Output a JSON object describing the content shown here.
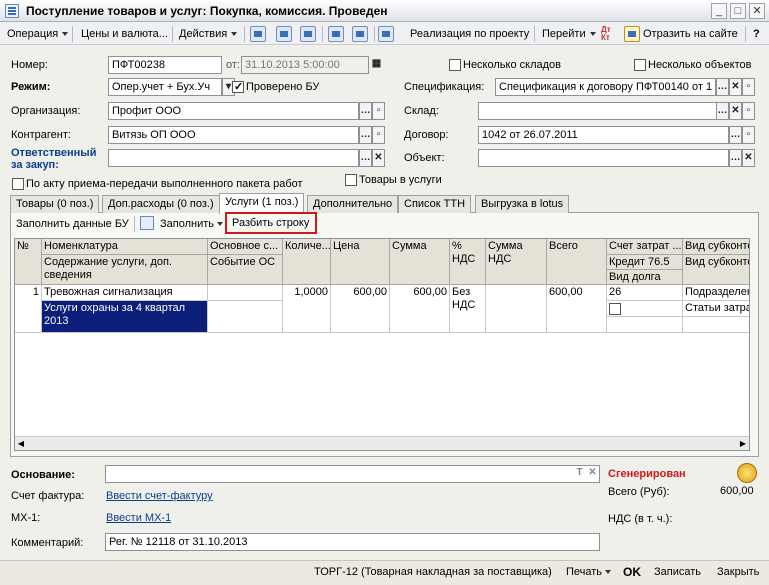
{
  "window": {
    "title": "Поступление товаров и услуг: Покупка, комиссия. Проведен",
    "minimize": "_",
    "maximize": "□",
    "close": "✕"
  },
  "toolbar": {
    "operation": "Операция",
    "prices": "Цены и валюта...",
    "actions": "Действия",
    "realization": "Реализация по проекту",
    "goto": "Перейти",
    "reflect": "Отразить на сайте",
    "dtkt": "Дт Кт"
  },
  "form": {
    "number_label": "Номер:",
    "number": "ПФТ00238",
    "date_label": "от:",
    "date": "31.10.2013  5:00:00",
    "multi_warehouses": "Несколько складов",
    "multi_objects": "Несколько объектов",
    "mode_label": "Режим:",
    "mode": "Опер.учет + Бух.Уч",
    "checked_bu": "Проверено БУ",
    "spec_label": "Спецификация:",
    "spec": "Спецификация к договору ПФТ00140 от 1",
    "org_label": "Организация:",
    "org": "Профит ООО",
    "warehouse_label": "Склад:",
    "warehouse": "",
    "contractor_label": "Контрагент:",
    "contractor": "Витязь ОП ООО",
    "contract_label": "Договор:",
    "contract": "1042 от 26.07.2011",
    "responsible_label": "Ответственный за закуп:",
    "responsible": "",
    "object_label": "Объект:",
    "object": "",
    "by_act": "По акту приема-передачи выполненного пакета работ",
    "goods_services": "Товары в услуги"
  },
  "tabs": [
    "Товары (0 поз.)",
    "Доп.расходы (0 поз.)",
    "Услуги (1 поз.)",
    "Дополнительно",
    "Список ТТН",
    "Выгрузка в lotus"
  ],
  "tab_toolbar": {
    "fill_bu": "Заполнить данные БУ",
    "fill": "Заполнить",
    "split": "Разбить строку"
  },
  "table": {
    "headers": {
      "n": "№",
      "nomen": "Номенклатура",
      "content": "Содержание услуги, доп. сведения",
      "osn": "Основное с...",
      "event": "Событие ОС",
      "qty": "Количе...",
      "price": "Цена",
      "sum": "Сумма",
      "pct": "% НДС",
      "vat": "Сумма НДС",
      "total": "Всего",
      "account": "Счет затрат ...",
      "credit": "Кредит 76.5",
      "debt": "Вид долга",
      "sub1": "Вид субконто",
      "sub2": "Вид субконто"
    },
    "rows": [
      {
        "n": "1",
        "nomen": "Тревожная сигнализация",
        "content": "Услуги охраны за 4 квартал 2013",
        "qty": "1,0000",
        "price": "600,00",
        "sum": "600,00",
        "pct": "Без НДС",
        "total": "600,00",
        "account": "26",
        "sub1": "Подразделен",
        "sub2": "Статьи затра"
      }
    ]
  },
  "bottom": {
    "basis_label": "Основание:",
    "basis": "",
    "generated": "Сгенерирован",
    "invoice_label": "Счет фактура:",
    "invoice_link": "Ввести счет-фактуру",
    "mx_label": "МХ-1:",
    "mx_link": "Ввести МХ-1",
    "total_label": "Всего (Руб):",
    "total": "600,00",
    "vat_label": "НДС (в т. ч.):",
    "vat": "",
    "comment_label": "Комментарий:",
    "comment": "Рег. №  12118 от 31.10.2013"
  },
  "footer": {
    "torg": "ТОРГ-12 (Товарная накладная за поставщика)",
    "print": "Печать",
    "ok": "OK",
    "save": "Записать",
    "close": "Закрыть"
  },
  "colors": {
    "selection": "#0a1e7a",
    "red_status": "#d0181c",
    "link": "#0a3e8c",
    "highlight_box": "#d0181c"
  }
}
